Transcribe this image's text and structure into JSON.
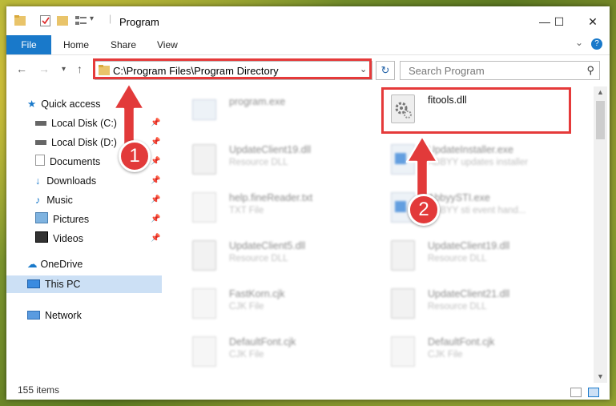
{
  "window": {
    "title": "Program",
    "controls": {
      "minimize": "—",
      "maximize": "☐",
      "close": "✕"
    }
  },
  "ribbon": {
    "tabs": [
      "File",
      "Home",
      "Share",
      "View"
    ],
    "collapse": "⌄",
    "help": "?"
  },
  "address": {
    "path": "C:\\Program Files\\Program Directory",
    "search_placeholder": "Search Program"
  },
  "nav": {
    "quick_access": "Quick access",
    "items": [
      "Local Disk (C:)",
      "Local Disk (D:)",
      "Documents",
      "Downloads",
      "Music",
      "Pictures",
      "Videos"
    ],
    "onedrive": "OneDrive",
    "this_pc": "This PC",
    "network": "Network"
  },
  "files": {
    "left": [
      {
        "name": "program.exe",
        "type": ""
      },
      {
        "name": "UpdateClient19.dll",
        "type": "Resource DLL"
      },
      {
        "name": "help.fineReader.txt",
        "type": "TXT File"
      },
      {
        "name": "UpdateClient5.dll",
        "type": "Resource DLL"
      },
      {
        "name": "FastKorn.cjk",
        "type": "CJK File"
      },
      {
        "name": "DefaultFont.cjk",
        "type": "CJK File"
      }
    ],
    "right": [
      {
        "name": "fitools.dll",
        "type": ""
      },
      {
        "name": "UpdateInstaller.exe",
        "type": "ABBYY updates installer"
      },
      {
        "name": "AbbyySTI.exe",
        "type": "ABBYY sti event hand..."
      },
      {
        "name": "UpdateClient19.dll",
        "type": "Resource DLL"
      },
      {
        "name": "UpdateClient21.dll",
        "type": "Resource DLL"
      },
      {
        "name": "DefaultFont.cjk",
        "type": "CJK File"
      }
    ]
  },
  "status": {
    "count": "155 items"
  },
  "annotations": {
    "badge1": "1",
    "badge2": "2"
  },
  "colors": {
    "accent": "#1979ca",
    "highlight": "#e53a3a",
    "selection": "#cce0f5"
  }
}
